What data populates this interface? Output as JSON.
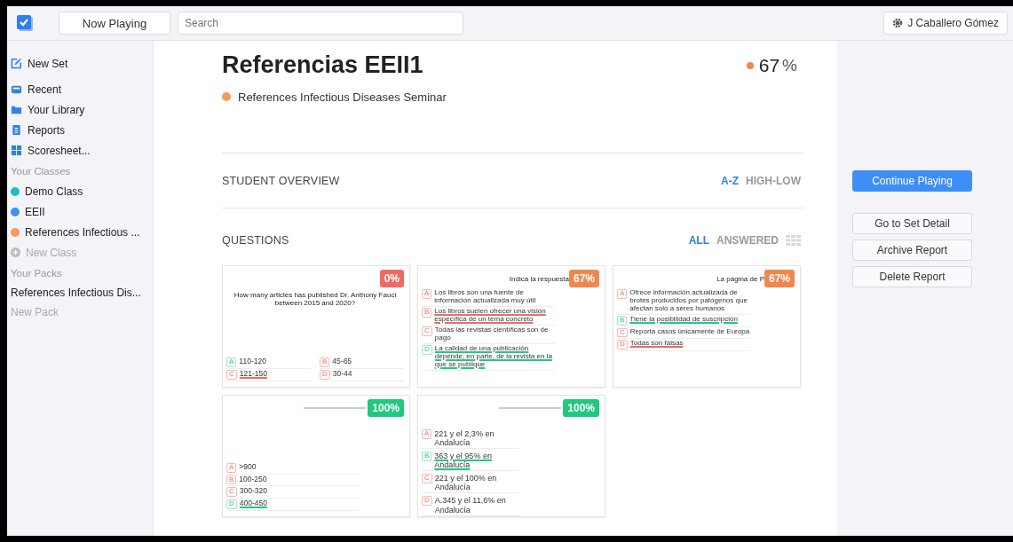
{
  "topbar": {
    "now_playing": "Now Playing",
    "search": {
      "placeholder": "Search"
    },
    "user": "J Caballero Gómez"
  },
  "sidebar": {
    "items": [
      {
        "label": "New Set"
      },
      {
        "label": "Recent"
      },
      {
        "label": "Your Library"
      },
      {
        "label": "Reports"
      },
      {
        "label": "Scoresheet..."
      }
    ],
    "classes_heading": "Your Classes",
    "classes": [
      {
        "label": "Demo Class",
        "color": "#1bbfc4"
      },
      {
        "label": "EEII",
        "color": "#3d8ef5"
      },
      {
        "label": "References Infectious ...",
        "color": "#f79a5e"
      }
    ],
    "new_class": "New Class",
    "packs_heading": "Your Packs",
    "packs": [
      "References Infectious Dis..."
    ],
    "new_pack": "New Pack"
  },
  "report": {
    "title": "Referencias EEII1",
    "score": {
      "value": "67",
      "unit": "%",
      "color": "#f0874e"
    },
    "class": {
      "name": "References Infectious Diseases Seminar",
      "color": "#f79a5e"
    }
  },
  "student_overview": {
    "heading": "STUDENT OVERVIEW",
    "sorts": [
      {
        "label": "A-Z",
        "selected": true
      },
      {
        "label": "HIGH-LOW",
        "selected": false
      }
    ]
  },
  "questions": {
    "heading": "QUESTIONS",
    "filters": [
      {
        "label": "ALL",
        "selected": true
      },
      {
        "label": "ANSWERED",
        "selected": false
      }
    ],
    "cards": [
      {
        "kind": "grid",
        "text": "How many articles has published Dr. Anthony Fauci between 2015 and 2020?",
        "score": "0%",
        "color": "#ef6a63",
        "options": [
          {
            "letter": "A",
            "text": "110-120",
            "correct": true,
            "chosen": false
          },
          {
            "letter": "B",
            "text": "45-65",
            "correct": false,
            "chosen": false
          },
          {
            "letter": "C",
            "text": "121-150",
            "correct": false,
            "chosen": true
          },
          {
            "letter": "D",
            "text": "30-44",
            "correct": false,
            "chosen": false
          }
        ]
      },
      {
        "kind": "list",
        "text": "Indica la respuesta",
        "score": "67%",
        "color": "#f0874e",
        "options": [
          {
            "letter": "A",
            "text": "Los libros son una fuente de información actualizada muy útil",
            "correct": false,
            "chosen": false
          },
          {
            "letter": "B",
            "text": "Los libros suelen ofrecer una visión específica de un tema concreto",
            "correct": false,
            "chosen": true
          },
          {
            "letter": "C",
            "text": "Todas las revistas científicas son de pago",
            "correct": false,
            "chosen": false
          },
          {
            "letter": "D",
            "text": "La calidad de una publicación depende, en parte, de la revista en la que se publique",
            "correct": true,
            "chosen": true
          }
        ]
      },
      {
        "kind": "list",
        "text": "La página de P",
        "score": "67%",
        "color": "#f0874e",
        "options": [
          {
            "letter": "A",
            "text": "Ofrece información actualizada de brotes producidos por patógenos que afectan solo a seres humanos",
            "correct": false,
            "chosen": false
          },
          {
            "letter": "B",
            "text": "Tiene la posibilidad de suscripción",
            "correct": true,
            "chosen": true
          },
          {
            "letter": "C",
            "text": "Reporta casos únicamente de Europa",
            "correct": false,
            "chosen": false
          },
          {
            "letter": "D",
            "text": "Todas son falsas",
            "correct": false,
            "chosen": true
          }
        ]
      },
      {
        "kind": "list_bottom",
        "score": "100%",
        "color": "#1fc97f",
        "options": [
          {
            "letter": "A",
            "text": ">900",
            "correct": false,
            "chosen": false
          },
          {
            "letter": "B",
            "text": "100-250",
            "correct": false,
            "chosen": false
          },
          {
            "letter": "C",
            "text": "300-320",
            "correct": false,
            "chosen": false
          },
          {
            "letter": "D",
            "text": "400-450",
            "correct": true,
            "chosen": true
          }
        ]
      },
      {
        "kind": "list",
        "score": "100%",
        "color": "#1fc97f",
        "options": [
          {
            "letter": "A",
            "text": "221 y el 2,3% en Andalucía",
            "correct": false,
            "chosen": false
          },
          {
            "letter": "B",
            "text": "363 y el 95% en Andalucía",
            "correct": true,
            "chosen": true
          },
          {
            "letter": "C",
            "text": "221 y el 100% en Andalucía",
            "correct": false,
            "chosen": false
          },
          {
            "letter": "D",
            "text": "A.345 y el 11,6% en Andalucía",
            "correct": false,
            "chosen": false
          }
        ]
      }
    ]
  },
  "actions": [
    {
      "label": "Continue Playing",
      "kind": "primary"
    },
    {
      "label": "Go to Set Detail",
      "kind": "secondary"
    },
    {
      "label": "Archive Report",
      "kind": "secondary"
    },
    {
      "label": "Delete Report",
      "kind": "secondary"
    }
  ]
}
